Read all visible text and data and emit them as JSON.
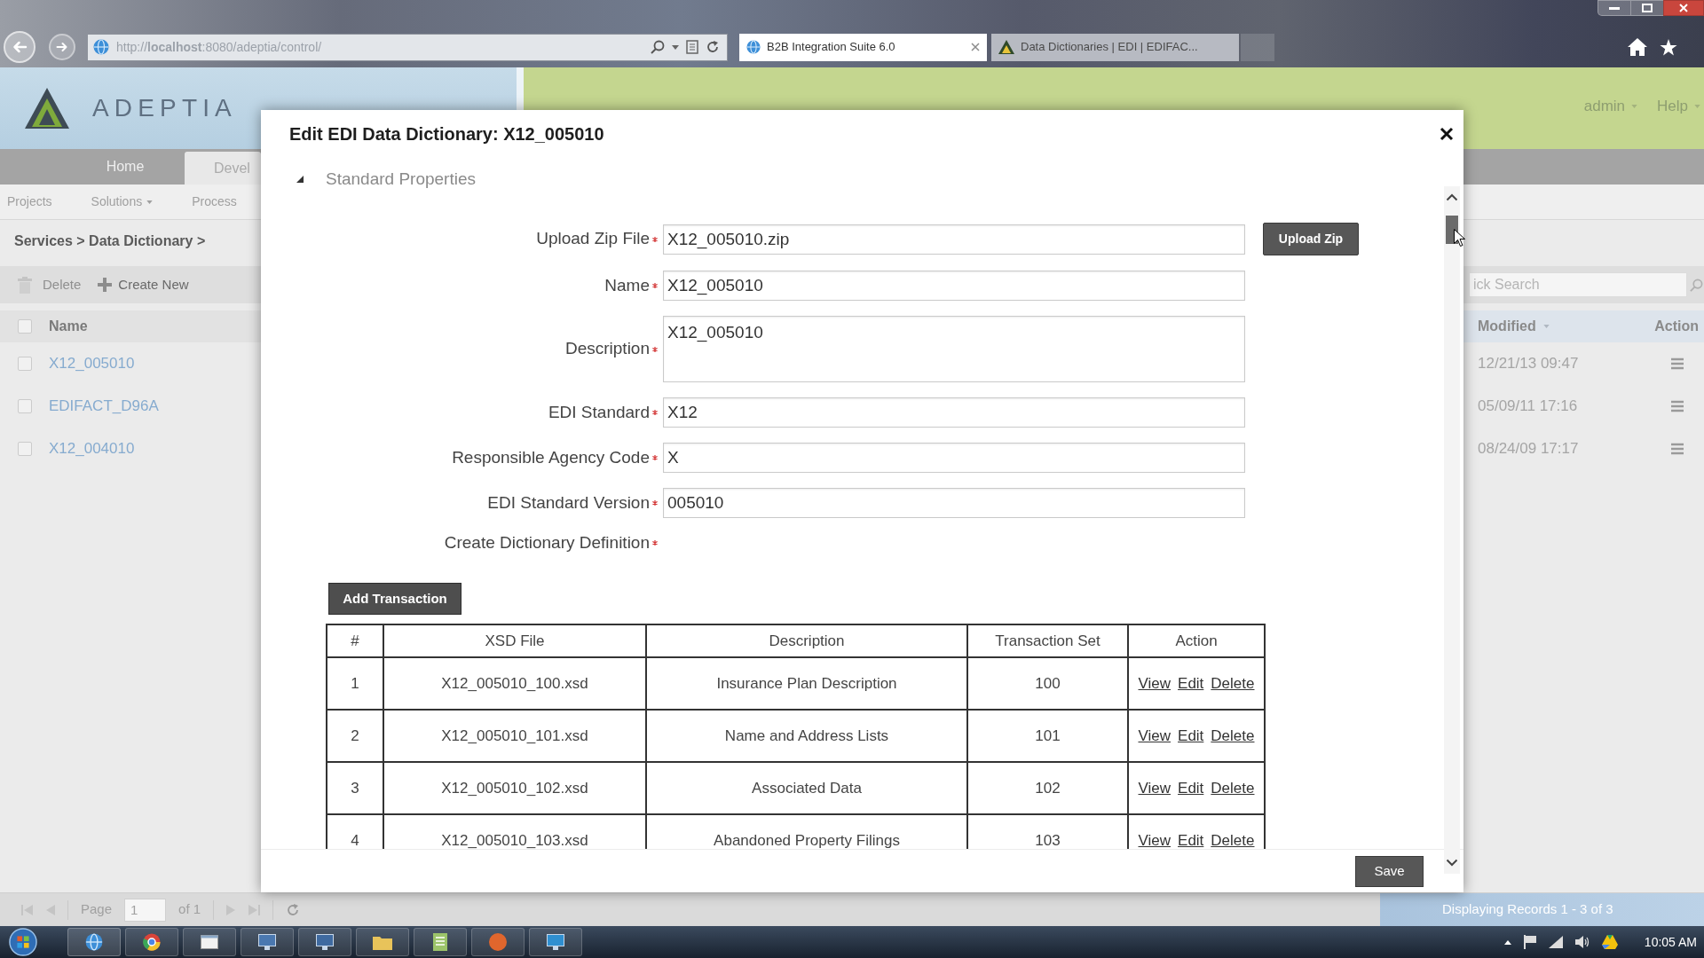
{
  "browser": {
    "address": "http://**localhost**:8080/adeptia/control/",
    "tabs": [
      {
        "label": "B2B Integration Suite 6.0",
        "selected": true,
        "kind": "globe"
      },
      {
        "label": "Data Dictionaries | EDI | EDIFAC...",
        "selected": false,
        "kind": "triangle"
      }
    ]
  },
  "header": {
    "logo": "ADEPTIA",
    "menus": [
      "admin",
      "Help"
    ]
  },
  "nav": {
    "tabs": [
      {
        "label": "Home",
        "selected": false
      },
      {
        "label": "Devel",
        "selected": true
      }
    ],
    "subnav": [
      {
        "label": "Projects",
        "dropdown": false
      },
      {
        "label": "Solutions",
        "dropdown": true
      },
      {
        "label": "Process",
        "dropdown": false
      }
    ]
  },
  "breadcrumb": "Services > Data Dictionary >",
  "toolbar": [
    {
      "kind": "delete",
      "label": "Delete",
      "disabled": true
    },
    {
      "kind": "create",
      "label": "Create New",
      "disabled": false
    }
  ],
  "quick_search": {
    "placeholder": "ick Search"
  },
  "grid": {
    "all_checked": false,
    "columns": [
      "Name",
      "Modified",
      "Action"
    ],
    "rows": [
      {
        "name": "X12_005010",
        "modified": "12/21/13 09:47",
        "checked": false
      },
      {
        "name": "EDIFACT_D96A",
        "modified": "05/09/11 17:16",
        "checked": false
      },
      {
        "name": "X12_004010",
        "modified": "08/24/09 17:17",
        "checked": false
      }
    ]
  },
  "pagination": {
    "label": "Page",
    "page": "1",
    "total": "of 1"
  },
  "status": "Displaying Records 1 - 3 of 3",
  "dialog": {
    "title": "Edit EDI Data Dictionary: X12_005010",
    "section": {
      "title": "Standard Properties",
      "expanded": true
    },
    "fields": [
      {
        "kind": "input",
        "label": "Upload Zip File",
        "required": true,
        "value": "X12_005010.zip",
        "button": "Upload Zip"
      },
      {
        "kind": "input",
        "label": "Name",
        "required": true,
        "value": "X12_005010"
      },
      {
        "kind": "textarea",
        "label": "Description",
        "required": true,
        "value": "X12_005010"
      },
      {
        "kind": "input",
        "label": "EDI Standard",
        "required": true,
        "value": "X12"
      },
      {
        "kind": "input",
        "label": "Responsible Agency Code",
        "required": true,
        "value": "X"
      },
      {
        "kind": "input",
        "label": "EDI Standard Version",
        "required": true,
        "value": "005010"
      },
      {
        "kind": "label",
        "label": "Create Dictionary Definition",
        "required": true
      }
    ],
    "add_button": "Add Transaction",
    "table": {
      "columns": [
        "#",
        "XSD File",
        "Description",
        "Transaction Set",
        "Action"
      ],
      "rows": [
        {
          "cells": [
            "1",
            "X12_005010_100.xsd",
            "Insurance Plan Description",
            "100"
          ],
          "actions": [
            "View",
            "Edit",
            "Delete"
          ]
        },
        {
          "cells": [
            "2",
            "X12_005010_101.xsd",
            "Name and Address Lists",
            "101"
          ],
          "actions": [
            "View",
            "Edit",
            "Delete"
          ]
        },
        {
          "cells": [
            "3",
            "X12_005010_102.xsd",
            "Associated Data",
            "102"
          ],
          "actions": [
            "View",
            "Edit",
            "Delete"
          ]
        },
        {
          "cells": [
            "4",
            "X12_005010_103.xsd",
            "Abandoned Property Filings",
            "103"
          ],
          "actions": [
            "View",
            "Edit",
            "Delete"
          ]
        }
      ]
    },
    "save_button": "Save"
  },
  "taskbar": {
    "clock": "10:05 AM"
  }
}
